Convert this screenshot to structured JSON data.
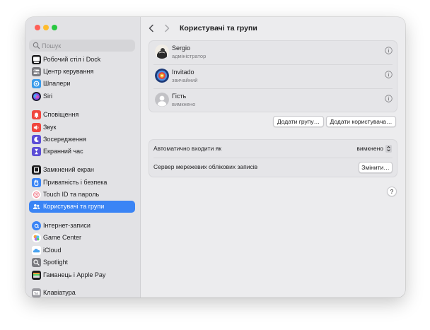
{
  "window": {
    "title": "Користувачі та групи"
  },
  "search": {
    "placeholder": "Пошук"
  },
  "sidebar": {
    "items": [
      {
        "label": "Робочий стіл і Dock",
        "icon": "dock-icon",
        "color": "#1d1d1f"
      },
      {
        "label": "Центр керування",
        "icon": "control-center-icon",
        "color": "#7b7b80"
      },
      {
        "label": "Шпалери",
        "icon": "wallpaper-icon",
        "color": "#3a9bea"
      },
      {
        "label": "Siri",
        "icon": "siri-icon",
        "color": "#1b1b2e"
      },
      {
        "label": "Сповіщення",
        "icon": "notifications-icon",
        "color": "#f0463e"
      },
      {
        "label": "Звук",
        "icon": "sound-icon",
        "color": "#f0463e"
      },
      {
        "label": "Зосередження",
        "icon": "focus-icon",
        "color": "#5b4dd6"
      },
      {
        "label": "Екранний час",
        "icon": "screen-time-icon",
        "color": "#5b4dd6"
      },
      {
        "label": "Замкнений екран",
        "icon": "lock-screen-icon",
        "color": "#1d1d1f"
      },
      {
        "label": "Приватність і безпека",
        "icon": "privacy-hand-icon",
        "color": "#3a84f5"
      },
      {
        "label": "Touch ID та пароль",
        "icon": "fingerprint-icon",
        "color": "#ffffff"
      },
      {
        "label": "Користувачі та групи",
        "icon": "users-icon",
        "color": "#3a84f5"
      },
      {
        "label": "Інтернет-записи",
        "icon": "internet-accounts-icon",
        "color": "#3a84f5"
      },
      {
        "label": "Game Center",
        "icon": "game-center-icon",
        "color": "#ffffff"
      },
      {
        "label": "iCloud",
        "icon": "icloud-icon",
        "color": "#ffffff"
      },
      {
        "label": "Spotlight",
        "icon": "spotlight-icon",
        "color": "#7b7b80"
      },
      {
        "label": "Гаманець і Apple Pay",
        "icon": "wallet-icon",
        "color": "#1d1d1f"
      },
      {
        "label": "Клавіатура",
        "icon": "keyboard-icon",
        "color": "#9a9aa0"
      }
    ],
    "active_index": 11
  },
  "users": [
    {
      "name": "Sergio",
      "role": "адміністратор",
      "avatar": "sergio-avatar"
    },
    {
      "name": "Invitado",
      "role": "звичайний",
      "avatar": "target-avatar"
    },
    {
      "name": "Гість",
      "role": "вимкнено",
      "avatar": "guest-avatar"
    }
  ],
  "buttons": {
    "add_group": "Додати групу…",
    "add_user": "Додати користувача…",
    "change": "Змінити…",
    "help": "?"
  },
  "settings": {
    "auto_login_label": "Автоматично входити як",
    "auto_login_value": "вимкнено",
    "network_server_label": "Сервер мережевих облікових записів"
  },
  "colors": {
    "accent": "#3a84f5",
    "close": "#ff5f57",
    "minimize": "#febc2e",
    "zoom": "#28c840"
  }
}
